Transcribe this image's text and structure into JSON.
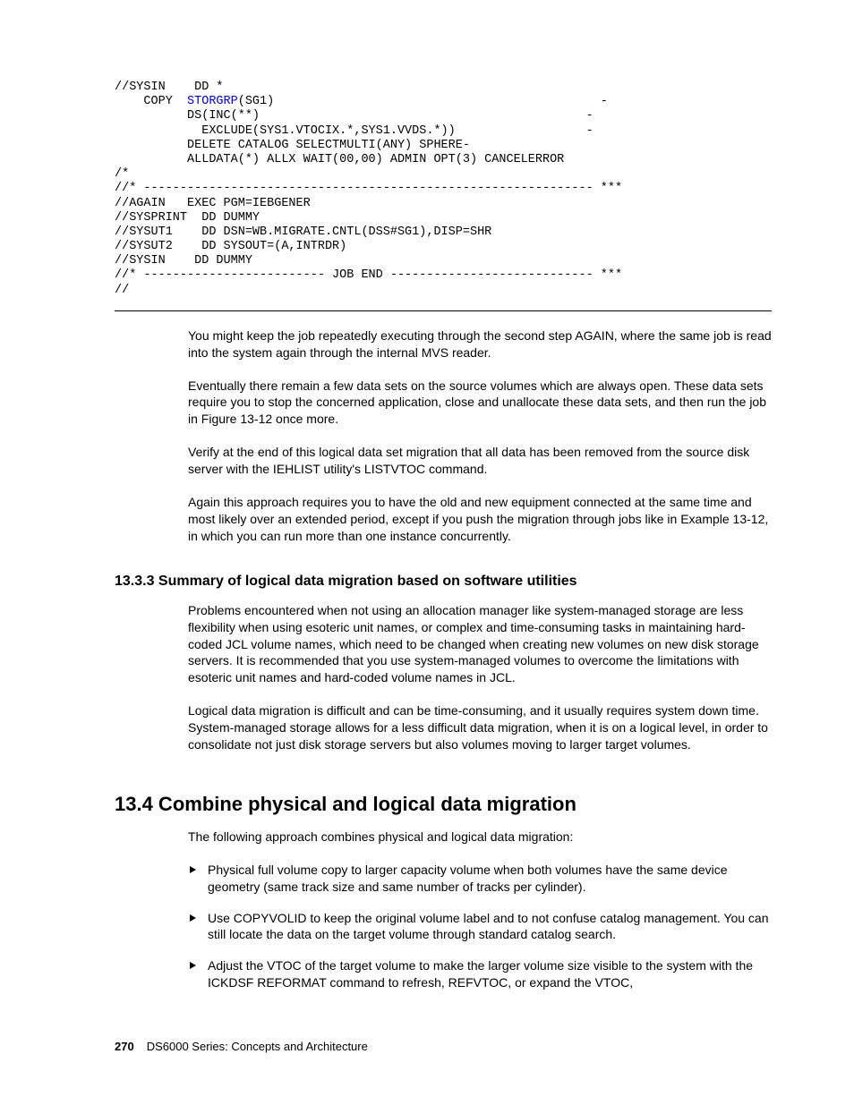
{
  "code": {
    "lines": [
      {
        "t": "//SYSIN    DD *"
      },
      {
        "t": "    COPY  ",
        "kw": "STORGRP",
        "rest": "(SG1)                                             -"
      },
      {
        "t": "          DS(INC(**)                                             -"
      },
      {
        "t": "            EXCLUDE(SYS1.VTOCIX.*,SYS1.VVDS.*))                  -"
      },
      {
        "t": "          DELETE CATALOG SELECTMULTI(ANY) SPHERE-"
      },
      {
        "t": "          ALLDATA(*) ALLX WAIT(00,00) ADMIN OPT(3) CANCELERROR"
      },
      {
        "t": "/*"
      },
      {
        "t": "//* -------------------------------------------------------------- ***"
      },
      {
        "t": "//AGAIN   EXEC PGM=IEBGENER"
      },
      {
        "t": "//SYSPRINT  DD DUMMY"
      },
      {
        "t": "//SYSUT1    DD DSN=WB.MIGRATE.CNTL(DSS#SG1),DISP=SHR"
      },
      {
        "t": "//SYSUT2    DD SYSOUT=(A,INTRDR)"
      },
      {
        "t": "//SYSIN    DD DUMMY"
      },
      {
        "t": "//* ------------------------- JOB END ---------------------------- ***"
      },
      {
        "t": "//"
      }
    ]
  },
  "paras": {
    "p1": "You might keep the job repeatedly executing through the second step AGAIN, where the same job is read into the system again through the internal MVS reader.",
    "p2": "Eventually there remain a few data sets on the source volumes which are always open. These data sets require you to stop the concerned application, close and unallocate these data sets, and then run the job in Figure 13-12 once more.",
    "p3": "Verify at the end of this logical data set migration that all data has been removed from the source disk server with the IEHLIST utility's LISTVTOC command.",
    "p4": "Again this approach requires you to have the old and new equipment connected at the same time and most likely over an extended period, except if you push the migration through jobs like in Example 13-12, in which you can run more than one instance concurrently."
  },
  "sub1": {
    "title": "13.3.3  Summary of logical data migration based on software utilities",
    "p1": "Problems encountered when not using an allocation manager like system-managed storage are less flexibility when using esoteric unit names, or complex and time-consuming tasks in maintaining hard-coded JCL volume names, which need to be changed when creating new volumes on new disk storage servers. It is recommended that you use system-managed volumes to overcome the limitations with esoteric unit names and hard-coded volume names in JCL.",
    "p2": "Logical data migration is difficult and can be time-consuming, and it usually requires system down time. System-managed storage allows for a less difficult data migration, when it is on a logical level, in order to consolidate not just disk storage servers but also volumes moving to larger target volumes."
  },
  "sec2": {
    "title": "13.4  Combine physical and logical data migration",
    "intro": "The following approach combines physical and logical data migration:",
    "bullets": [
      "Physical full volume copy to larger capacity volume when both volumes have the same device geometry (same track size and same number of tracks per cylinder).",
      "Use COPYVOLID to keep the original volume label and to not confuse catalog management. You can still locate the data on the target volume through standard catalog search.",
      "Adjust the VTOC of the target volume to make the larger volume size visible to the system with the ICKDSF REFORMAT command to refresh, REFVTOC, or expand the VTOC,"
    ]
  },
  "footer": {
    "page": "270",
    "title": "DS6000 Series: Concepts and Architecture"
  }
}
